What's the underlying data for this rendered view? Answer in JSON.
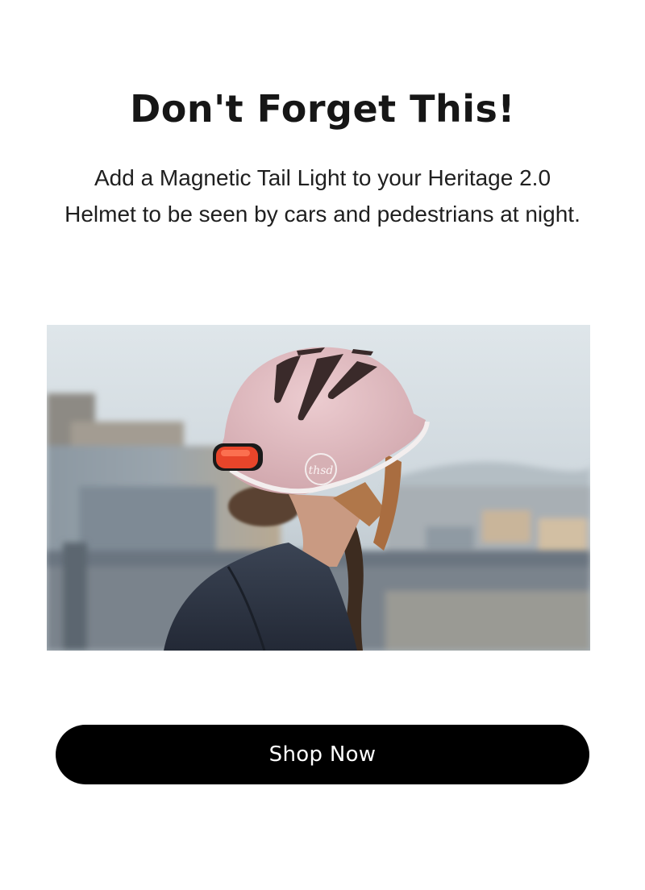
{
  "headline": "Don't Forget This!",
  "body_text": "Add a Magnetic Tail Light to your Heritage 2.0 Helmet to be seen by cars and pedestrians at night.",
  "hero": {
    "helmet_logo": "thsd",
    "helmet_color": "#e5c3c7",
    "tail_light_color": "#e8452a"
  },
  "cta": {
    "label": "Shop Now"
  }
}
